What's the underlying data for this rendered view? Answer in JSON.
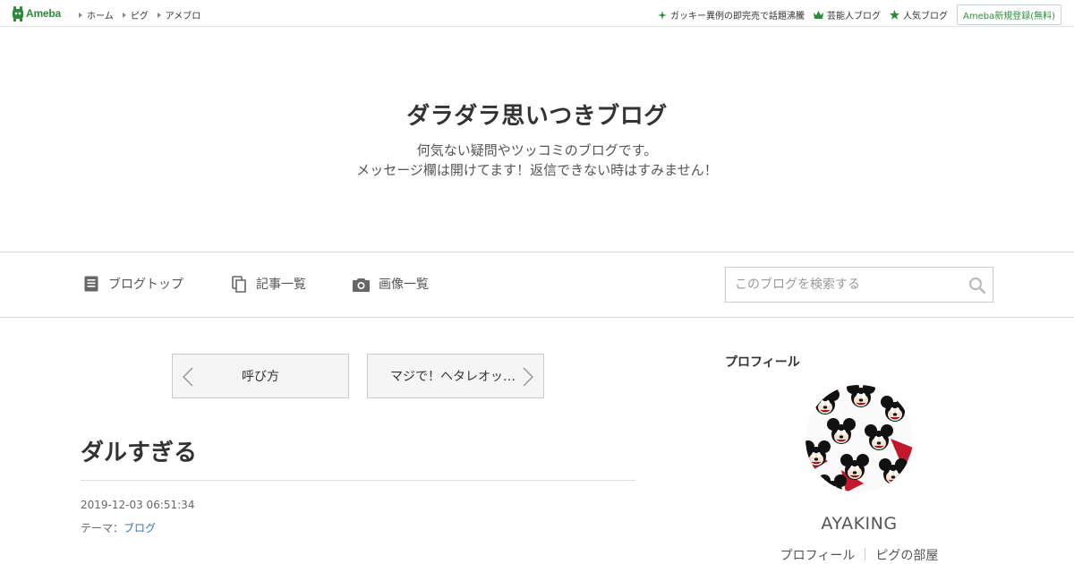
{
  "topbar": {
    "logo_text": "Ameba",
    "nav": [
      "ホーム",
      "ピグ",
      "アメブロ"
    ],
    "right_links": [
      {
        "label": "ガッキー異例の即完売で話題沸騰",
        "icon": "sparkle-icon"
      },
      {
        "label": "芸能人ブログ",
        "icon": "crown-icon"
      },
      {
        "label": "人気ブログ",
        "icon": "star-icon"
      }
    ],
    "register_label": "Ameba新規登録(無料)"
  },
  "header": {
    "title": "ダラダラ思いつきブログ",
    "desc_line1": "何気ない疑問やツッコミのブログです。",
    "desc_line2": "メッセージ欄は開けてます！返信できない時はすみません！"
  },
  "nav": {
    "blog_top": "ブログトップ",
    "entry_list": "記事一覧",
    "image_list": "画像一覧",
    "search_placeholder": "このブログを検索する"
  },
  "article": {
    "prev_label": "呼び方",
    "next_label": "マジで！ヘタレオッ…",
    "title": "ダルすぎる",
    "date": "2019-12-03 06:51:34",
    "theme_prefix": "テーマ：",
    "theme": "ブログ"
  },
  "sidebar": {
    "heading": "プロフィール",
    "name": "AYAKING",
    "links": [
      "プロフィール",
      "ピグの部屋"
    ]
  },
  "colors": {
    "brand": "#2d8c3c",
    "link": "#3a73b8"
  }
}
